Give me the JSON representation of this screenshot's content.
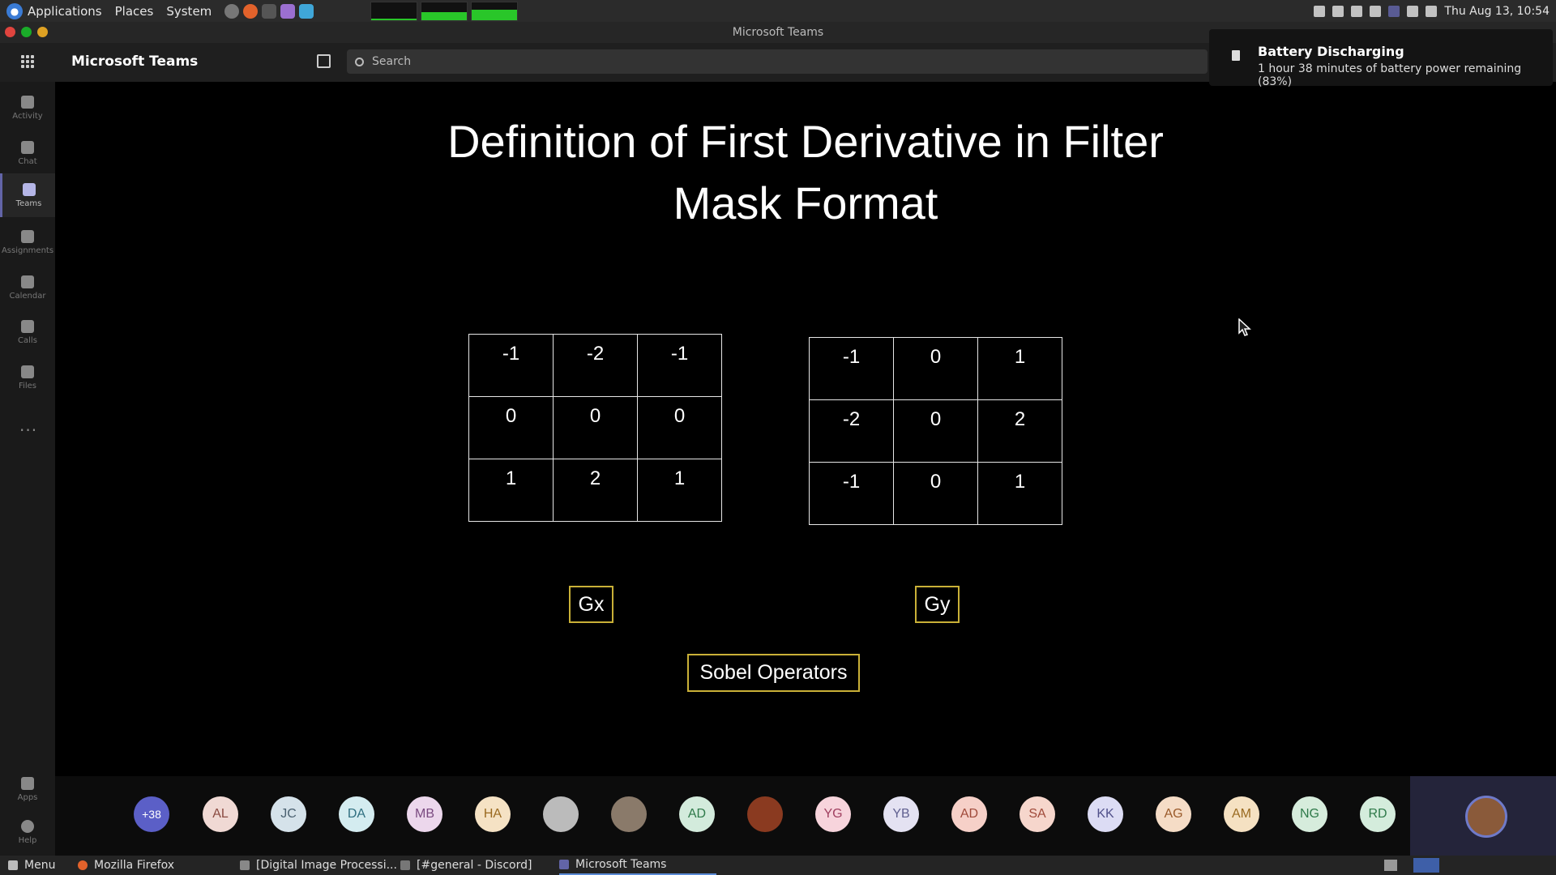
{
  "system_panel": {
    "menus": [
      "Applications",
      "Places",
      "System"
    ],
    "clock": "Thu Aug 13, 10:54",
    "graph_levels": [
      0.08,
      0.45,
      0.55
    ]
  },
  "window": {
    "title": "Microsoft Teams"
  },
  "teams": {
    "app_name": "Microsoft Teams",
    "search_placeholder": "Search"
  },
  "rail": {
    "items": [
      {
        "label": "Activity",
        "icon": "bell-icon"
      },
      {
        "label": "Chat",
        "icon": "chat-icon"
      },
      {
        "label": "Teams",
        "icon": "teams-icon",
        "active": true
      },
      {
        "label": "Assignments",
        "icon": "assignments-icon"
      },
      {
        "label": "Calendar",
        "icon": "calendar-icon"
      },
      {
        "label": "Calls",
        "icon": "phone-icon"
      },
      {
        "label": "Files",
        "icon": "file-icon"
      }
    ],
    "apps_label": "Apps",
    "help_label": "Help",
    "more_label": "···"
  },
  "notification": {
    "title": "Battery Discharging",
    "body": "1 hour 38 minutes of battery power remaining (83%)"
  },
  "slide": {
    "title_line1": "Definition of First Derivative in Filter",
    "title_line2": "Mask Format",
    "gx": [
      [
        "-1",
        "-2",
        "-1"
      ],
      [
        "0",
        "0",
        "0"
      ],
      [
        "1",
        "2",
        "1"
      ]
    ],
    "gy": [
      [
        "-1",
        "0",
        "1"
      ],
      [
        "-2",
        "0",
        "2"
      ],
      [
        "-1",
        "0",
        "1"
      ]
    ],
    "gx_label": "Gx",
    "gy_label": "Gy",
    "caption": "Sobel Operators"
  },
  "participants": {
    "overflow": "+38",
    "initials": [
      "AL",
      "JC",
      "DA",
      "MB",
      "HA",
      "",
      "",
      "AD",
      "",
      "YG",
      "YB",
      "AD",
      "SA",
      "KK",
      "AG",
      "AM",
      "NG",
      "RD"
    ],
    "colors": [
      "#f0d9d4",
      "#d5e2ea",
      "#d4ecf0",
      "#ecd7ec",
      "#f5e2c4",
      "#bbbbbb",
      "#8a7a6a",
      "#d3ebdc",
      "#8a3a20",
      "#f7d4dc",
      "#e4e2f2",
      "#f6d0c8",
      "#f6d6cc",
      "#dcdcf4",
      "#f5dcc6",
      "#f5e1c2",
      "#d6ecdc",
      "#d4ecdc"
    ],
    "text_colors": [
      "#8a4a40",
      "#4a6070",
      "#2f6f80",
      "#7a4a80",
      "#9a6a20",
      "#333",
      "#333",
      "#2f7a4a",
      "#fff",
      "#a04060",
      "#606090",
      "#a04a3a",
      "#a04a3a",
      "#50508a",
      "#9a5a2a",
      "#9a6a20",
      "#2f7a4a",
      "#2f7a4a"
    ]
  },
  "taskbar": {
    "menu": "Menu",
    "items": [
      "Mozilla Firefox",
      "[Digital Image Processi...",
      "[#general - Discord]",
      "Microsoft Teams"
    ]
  }
}
